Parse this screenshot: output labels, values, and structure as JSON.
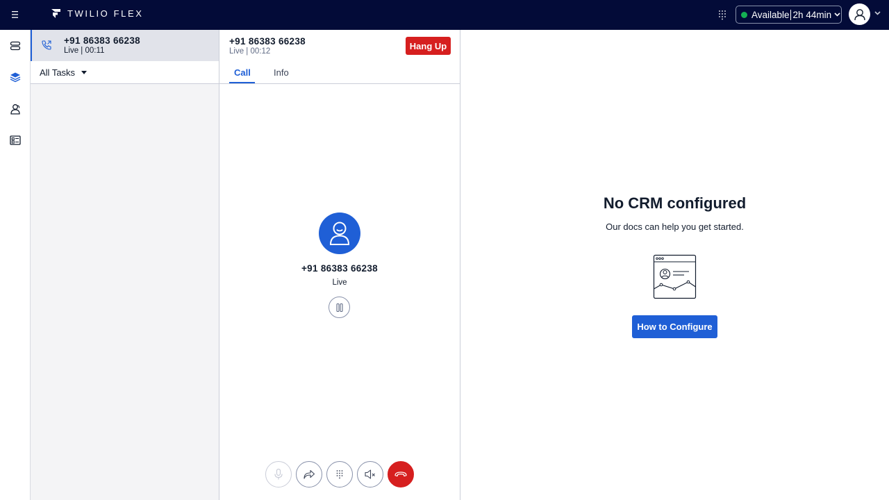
{
  "header": {
    "brand": "TWILIO FLEX",
    "activity": "Available",
    "timer": "2h 44min"
  },
  "task": {
    "title": "+91 86383 66238",
    "subtitle": "Live | 00:11"
  },
  "filter": {
    "label": "All Tasks"
  },
  "call": {
    "title": "+91 86383 66238",
    "subtitle": "Live | 00:12",
    "hangup_label": "Hang Up",
    "tabs": [
      {
        "label": "Call",
        "active": true
      },
      {
        "label": "Info",
        "active": false
      }
    ],
    "caller_number": "+91 86383 66238",
    "caller_status": "Live"
  },
  "crm": {
    "title": "No CRM configured",
    "subtitle": "Our docs can help you get started.",
    "button_label": "How to Configure"
  },
  "colors": {
    "topbar": "#030b38",
    "accent": "#1f5fd6",
    "danger": "#d61f1f",
    "available": "#14b053"
  },
  "icons": {
    "nav": [
      "queues-icon",
      "tasks-layers-icon",
      "teams-icon",
      "dashboard-icon"
    ],
    "controls": [
      "microphone-icon",
      "transfer-icon",
      "dialpad-icon",
      "speaker-mute-icon",
      "end-call-icon"
    ]
  }
}
